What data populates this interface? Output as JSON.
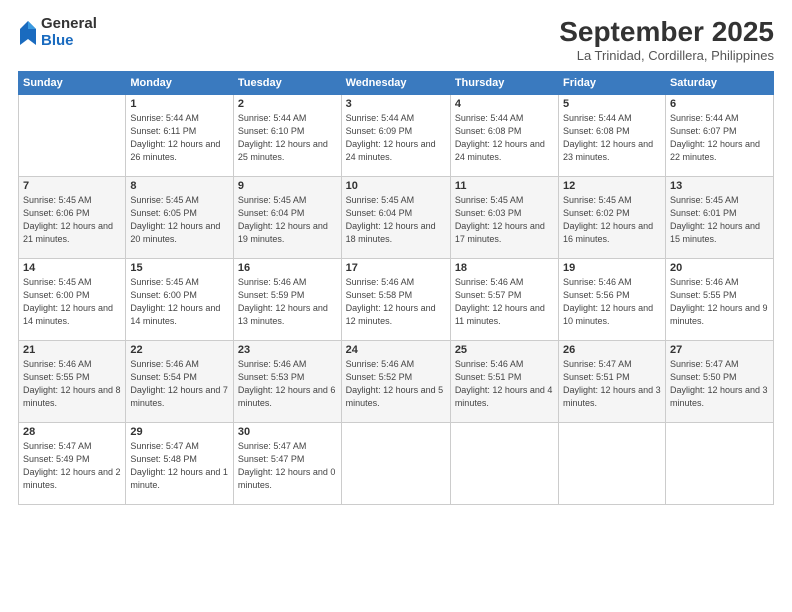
{
  "logo": {
    "general": "General",
    "blue": "Blue"
  },
  "header": {
    "month": "September 2025",
    "location": "La Trinidad, Cordillera, Philippines"
  },
  "days_of_week": [
    "Sunday",
    "Monday",
    "Tuesday",
    "Wednesday",
    "Thursday",
    "Friday",
    "Saturday"
  ],
  "weeks": [
    [
      {
        "day": "",
        "sunrise": "",
        "sunset": "",
        "daylight": ""
      },
      {
        "day": "1",
        "sunrise": "Sunrise: 5:44 AM",
        "sunset": "Sunset: 6:11 PM",
        "daylight": "Daylight: 12 hours and 26 minutes."
      },
      {
        "day": "2",
        "sunrise": "Sunrise: 5:44 AM",
        "sunset": "Sunset: 6:10 PM",
        "daylight": "Daylight: 12 hours and 25 minutes."
      },
      {
        "day": "3",
        "sunrise": "Sunrise: 5:44 AM",
        "sunset": "Sunset: 6:09 PM",
        "daylight": "Daylight: 12 hours and 24 minutes."
      },
      {
        "day": "4",
        "sunrise": "Sunrise: 5:44 AM",
        "sunset": "Sunset: 6:08 PM",
        "daylight": "Daylight: 12 hours and 24 minutes."
      },
      {
        "day": "5",
        "sunrise": "Sunrise: 5:44 AM",
        "sunset": "Sunset: 6:08 PM",
        "daylight": "Daylight: 12 hours and 23 minutes."
      },
      {
        "day": "6",
        "sunrise": "Sunrise: 5:44 AM",
        "sunset": "Sunset: 6:07 PM",
        "daylight": "Daylight: 12 hours and 22 minutes."
      }
    ],
    [
      {
        "day": "7",
        "sunrise": "Sunrise: 5:45 AM",
        "sunset": "Sunset: 6:06 PM",
        "daylight": "Daylight: 12 hours and 21 minutes."
      },
      {
        "day": "8",
        "sunrise": "Sunrise: 5:45 AM",
        "sunset": "Sunset: 6:05 PM",
        "daylight": "Daylight: 12 hours and 20 minutes."
      },
      {
        "day": "9",
        "sunrise": "Sunrise: 5:45 AM",
        "sunset": "Sunset: 6:04 PM",
        "daylight": "Daylight: 12 hours and 19 minutes."
      },
      {
        "day": "10",
        "sunrise": "Sunrise: 5:45 AM",
        "sunset": "Sunset: 6:04 PM",
        "daylight": "Daylight: 12 hours and 18 minutes."
      },
      {
        "day": "11",
        "sunrise": "Sunrise: 5:45 AM",
        "sunset": "Sunset: 6:03 PM",
        "daylight": "Daylight: 12 hours and 17 minutes."
      },
      {
        "day": "12",
        "sunrise": "Sunrise: 5:45 AM",
        "sunset": "Sunset: 6:02 PM",
        "daylight": "Daylight: 12 hours and 16 minutes."
      },
      {
        "day": "13",
        "sunrise": "Sunrise: 5:45 AM",
        "sunset": "Sunset: 6:01 PM",
        "daylight": "Daylight: 12 hours and 15 minutes."
      }
    ],
    [
      {
        "day": "14",
        "sunrise": "Sunrise: 5:45 AM",
        "sunset": "Sunset: 6:00 PM",
        "daylight": "Daylight: 12 hours and 14 minutes."
      },
      {
        "day": "15",
        "sunrise": "Sunrise: 5:45 AM",
        "sunset": "Sunset: 6:00 PM",
        "daylight": "Daylight: 12 hours and 14 minutes."
      },
      {
        "day": "16",
        "sunrise": "Sunrise: 5:46 AM",
        "sunset": "Sunset: 5:59 PM",
        "daylight": "Daylight: 12 hours and 13 minutes."
      },
      {
        "day": "17",
        "sunrise": "Sunrise: 5:46 AM",
        "sunset": "Sunset: 5:58 PM",
        "daylight": "Daylight: 12 hours and 12 minutes."
      },
      {
        "day": "18",
        "sunrise": "Sunrise: 5:46 AM",
        "sunset": "Sunset: 5:57 PM",
        "daylight": "Daylight: 12 hours and 11 minutes."
      },
      {
        "day": "19",
        "sunrise": "Sunrise: 5:46 AM",
        "sunset": "Sunset: 5:56 PM",
        "daylight": "Daylight: 12 hours and 10 minutes."
      },
      {
        "day": "20",
        "sunrise": "Sunrise: 5:46 AM",
        "sunset": "Sunset: 5:55 PM",
        "daylight": "Daylight: 12 hours and 9 minutes."
      }
    ],
    [
      {
        "day": "21",
        "sunrise": "Sunrise: 5:46 AM",
        "sunset": "Sunset: 5:55 PM",
        "daylight": "Daylight: 12 hours and 8 minutes."
      },
      {
        "day": "22",
        "sunrise": "Sunrise: 5:46 AM",
        "sunset": "Sunset: 5:54 PM",
        "daylight": "Daylight: 12 hours and 7 minutes."
      },
      {
        "day": "23",
        "sunrise": "Sunrise: 5:46 AM",
        "sunset": "Sunset: 5:53 PM",
        "daylight": "Daylight: 12 hours and 6 minutes."
      },
      {
        "day": "24",
        "sunrise": "Sunrise: 5:46 AM",
        "sunset": "Sunset: 5:52 PM",
        "daylight": "Daylight: 12 hours and 5 minutes."
      },
      {
        "day": "25",
        "sunrise": "Sunrise: 5:46 AM",
        "sunset": "Sunset: 5:51 PM",
        "daylight": "Daylight: 12 hours and 4 minutes."
      },
      {
        "day": "26",
        "sunrise": "Sunrise: 5:47 AM",
        "sunset": "Sunset: 5:51 PM",
        "daylight": "Daylight: 12 hours and 3 minutes."
      },
      {
        "day": "27",
        "sunrise": "Sunrise: 5:47 AM",
        "sunset": "Sunset: 5:50 PM",
        "daylight": "Daylight: 12 hours and 3 minutes."
      }
    ],
    [
      {
        "day": "28",
        "sunrise": "Sunrise: 5:47 AM",
        "sunset": "Sunset: 5:49 PM",
        "daylight": "Daylight: 12 hours and 2 minutes."
      },
      {
        "day": "29",
        "sunrise": "Sunrise: 5:47 AM",
        "sunset": "Sunset: 5:48 PM",
        "daylight": "Daylight: 12 hours and 1 minute."
      },
      {
        "day": "30",
        "sunrise": "Sunrise: 5:47 AM",
        "sunset": "Sunset: 5:47 PM",
        "daylight": "Daylight: 12 hours and 0 minutes."
      },
      {
        "day": "",
        "sunrise": "",
        "sunset": "",
        "daylight": ""
      },
      {
        "day": "",
        "sunrise": "",
        "sunset": "",
        "daylight": ""
      },
      {
        "day": "",
        "sunrise": "",
        "sunset": "",
        "daylight": ""
      },
      {
        "day": "",
        "sunrise": "",
        "sunset": "",
        "daylight": ""
      }
    ]
  ]
}
